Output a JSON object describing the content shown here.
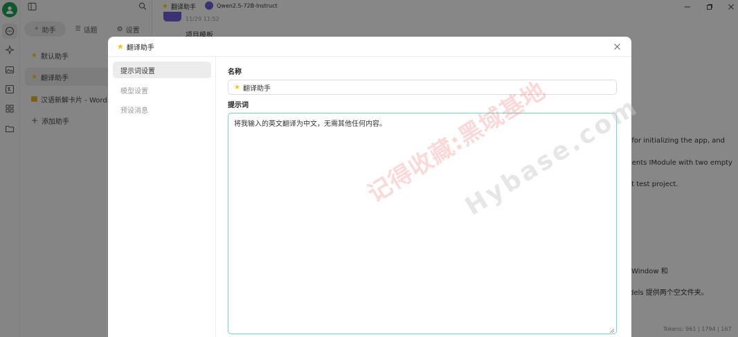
{
  "topbar": {
    "assistant_name": "翻译助手",
    "model_name": "Qwen2.5-72B-Instruct"
  },
  "sidebar": {
    "tabs": [
      {
        "label": "助手"
      },
      {
        "label": "话题"
      },
      {
        "label": "设置"
      }
    ],
    "items": [
      {
        "label": "默认助手"
      },
      {
        "label": "翻译助手"
      },
      {
        "label": "汉语新解卡片 - Word..."
      },
      {
        "label": "添加助手"
      }
    ]
  },
  "chat": {
    "timestamp": "11/29 11:52",
    "section_label": "项目模板",
    "lines": [
      "e for initializing the app, and",
      "ments IModule with two empty",
      "nit test project.",
      "inWindow 和",
      "odels 提供两个空文件夹。"
    ],
    "tokens": "Tokens: 961 | 1794 | 167"
  },
  "modal": {
    "title": "翻译助手",
    "nav": [
      {
        "label": "提示词设置"
      },
      {
        "label": "模型设置"
      },
      {
        "label": "预设消息"
      }
    ],
    "name_label": "名称",
    "name_value": "翻译助手",
    "prompt_label": "提示词",
    "prompt_value": "将我输入的英文翻译为中文，无需其他任何内容。"
  },
  "watermark": {
    "text_cn": "记得收藏:黑域基地",
    "text_en": "Hybase.com"
  },
  "colors": {
    "avatar": "#1f9d55",
    "accent_border": "#7fd0c4",
    "star": "#f5c518",
    "model_icon": "#6b5bd3"
  }
}
